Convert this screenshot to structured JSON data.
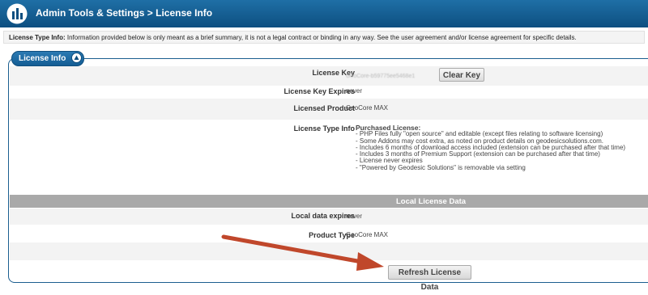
{
  "header": {
    "title": "Admin Tools & Settings > License Info",
    "icon": "bar-chart-icon"
  },
  "notice": {
    "label": "License Type Info:",
    "text": " Information provided below is only meant as a brief summary, it is not a legal contract or binding in any way. See the user agreement and/or license agreement for specific details."
  },
  "panel": {
    "title": "License Info",
    "collapse_icon": "chevron-up-icon"
  },
  "license": {
    "key_label": "License Key",
    "key_value": "GeoCore-b59775ee5468e1",
    "clear_button": "Clear Key",
    "expires_label": "License Key Expires",
    "expires_value": "never",
    "product_label": "Licensed Product",
    "product_value": "GeoCore MAX",
    "type_label": "License Type Info",
    "type_heading": "Purchased License:",
    "type_lines": [
      "- PHP Files fully \"open source\" and editable (except files relating to software licensing)",
      "- Some Addons may cost extra, as noted on product details on geodesicsolutions.com.",
      "- Includes 6 months of download access included (extension can be purchased after that time)",
      "- Includes 3 months of Premium Support (extension can be purchased after that time)",
      "- License never expires",
      "- \"Powered by Geodesic Solutions\" is removable via setting"
    ]
  },
  "local": {
    "section_title": "Local License Data",
    "expires_label": "Local data expires",
    "expires_value": "never",
    "product_label": "Product Type",
    "product_value": "GeoCore MAX",
    "refresh_button": "Refresh License Data"
  },
  "colors": {
    "header": "#0d4f80",
    "panel_border": "#1b5e8f",
    "section_bar": "#a9a9a9",
    "arrow": "#c0472b"
  }
}
